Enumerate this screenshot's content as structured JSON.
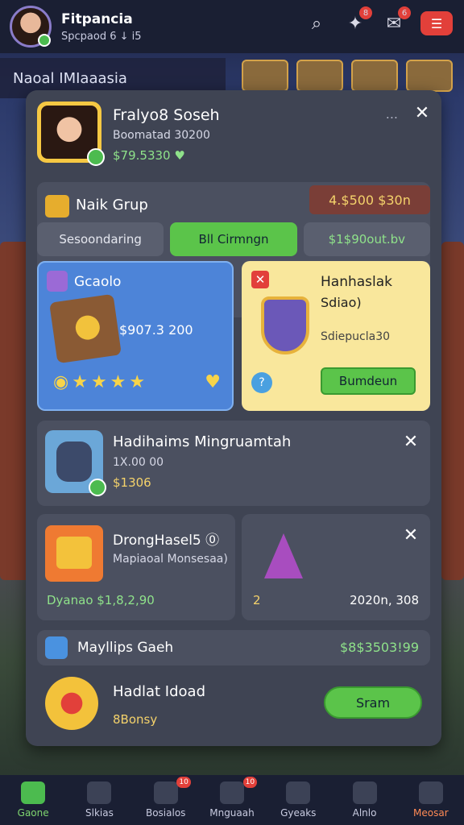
{
  "topbar": {
    "name": "Fitpancia",
    "subtitle": "Spcpaod 6 ↓ i5"
  },
  "location": "Naoal IMIaaasia",
  "panel": {
    "profile": {
      "name": "Fralyo8 Soseh",
      "level": "Boomatad 30200",
      "coins": "$79.5330 ♥"
    },
    "group": {
      "name": "Naik Grup",
      "amount": "4.$500 $30n",
      "tabs": [
        "Sesoondaring",
        "Bll Cirmngn",
        "$1$90out.bv"
      ]
    },
    "blue_card": {
      "title": "Gcaolo",
      "value": "$907.3 200"
    },
    "yellow_card": {
      "title": "Hanhaslak",
      "subtitle": "Sdiao)",
      "desc": "Sdiepucla30",
      "button": "Bumdeun"
    },
    "row1": {
      "title": "Hadihaims Mingruamtah",
      "subtitle": "1X.00 00",
      "amount": "$1306"
    },
    "row2a": {
      "title": "DrongHasel5 ⓪",
      "subtitle": "Mapiaoal Monsesaa)",
      "amount": "Dyanao $1,8,2,90"
    },
    "row2b": {
      "count": "2",
      "amount": "2020n, 308"
    },
    "row3": {
      "title": "Mayllips Gaeh",
      "amount": "$8$3503!99"
    },
    "row4": {
      "title": "Hadlat Idoad",
      "subtitle": "8Bonsy",
      "button": "Sram"
    }
  },
  "bottomnav": [
    {
      "label": "Gaone",
      "badge": ""
    },
    {
      "label": "Slkias",
      "badge": ""
    },
    {
      "label": "Bosialos",
      "badge": "10"
    },
    {
      "label": "Mnguaah",
      "badge": "10"
    },
    {
      "label": "Gyeaks",
      "badge": ""
    },
    {
      "label": "Alnlo",
      "badge": ""
    },
    {
      "label": "Meosar",
      "badge": ""
    }
  ]
}
